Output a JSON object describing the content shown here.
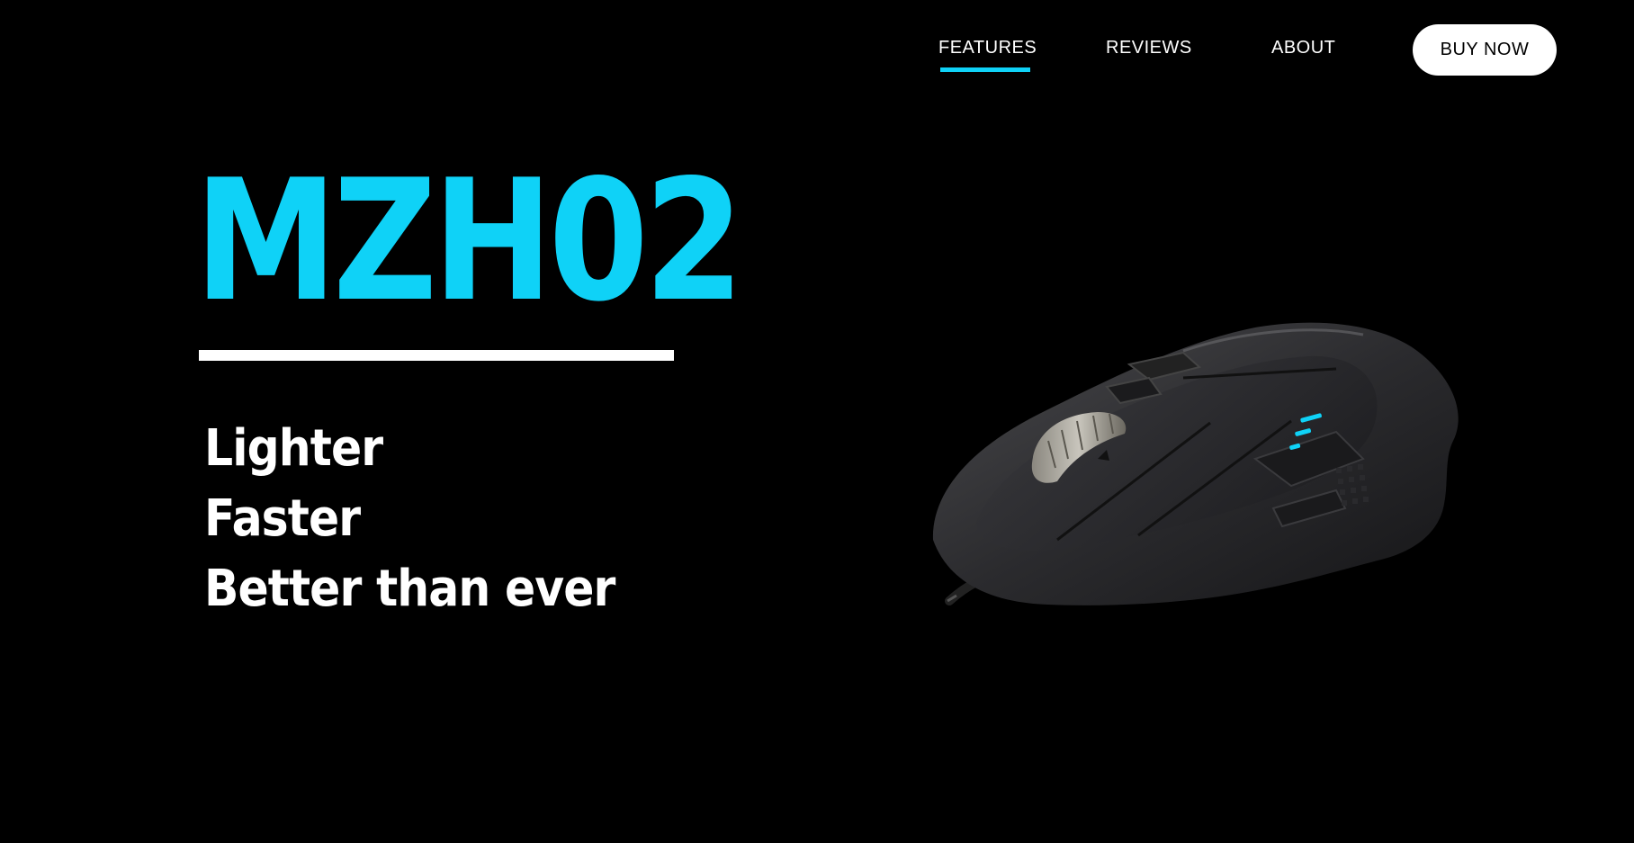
{
  "nav": {
    "features_label": "FEATURES",
    "reviews_label": "REVIEWS",
    "about_label": "ABOUT",
    "buy_label": "BUY NOW",
    "active_tab": "FEATURES"
  },
  "hero": {
    "title": "MZH02",
    "taglines": [
      "Lighter",
      "Faster",
      "Better than ever"
    ]
  },
  "product": {
    "image_icon": "gaming-mouse-image"
  },
  "colors": {
    "background": "#000000",
    "accent": "#0fd2f7",
    "text": "#ffffff"
  }
}
